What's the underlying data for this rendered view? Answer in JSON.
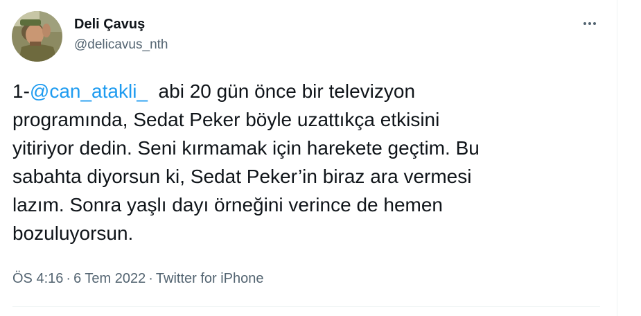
{
  "author": {
    "display_name": "Deli Çavuş",
    "handle": "@delicavus_nth"
  },
  "tweet": {
    "prefix": "1-",
    "mention": "@can_atakli_",
    "line1_rest": "  abi 20 gün önce bir televizyon",
    "lines": [
      "programında, Sedat Peker böyle uzattıkça etkisini",
      "yitiriyor dedin. Seni kırmamak için harekete geçtim. Bu",
      "sabahta diyorsun ki, Sedat Peker’in biraz ara vermesi",
      "lazım. Sonra yaşlı dayı örneğini verince de hemen",
      "bozuluyorsun."
    ]
  },
  "meta": {
    "time": "ÖS 4:16",
    "separator": "·",
    "date": "6 Tem 2022",
    "source": "Twitter for iPhone"
  },
  "icons": {
    "more": "more-horizontal-icon"
  },
  "colors": {
    "link": "#1d9bf0",
    "text": "#0f1419",
    "secondary": "#536471",
    "border": "#eff3f4"
  }
}
